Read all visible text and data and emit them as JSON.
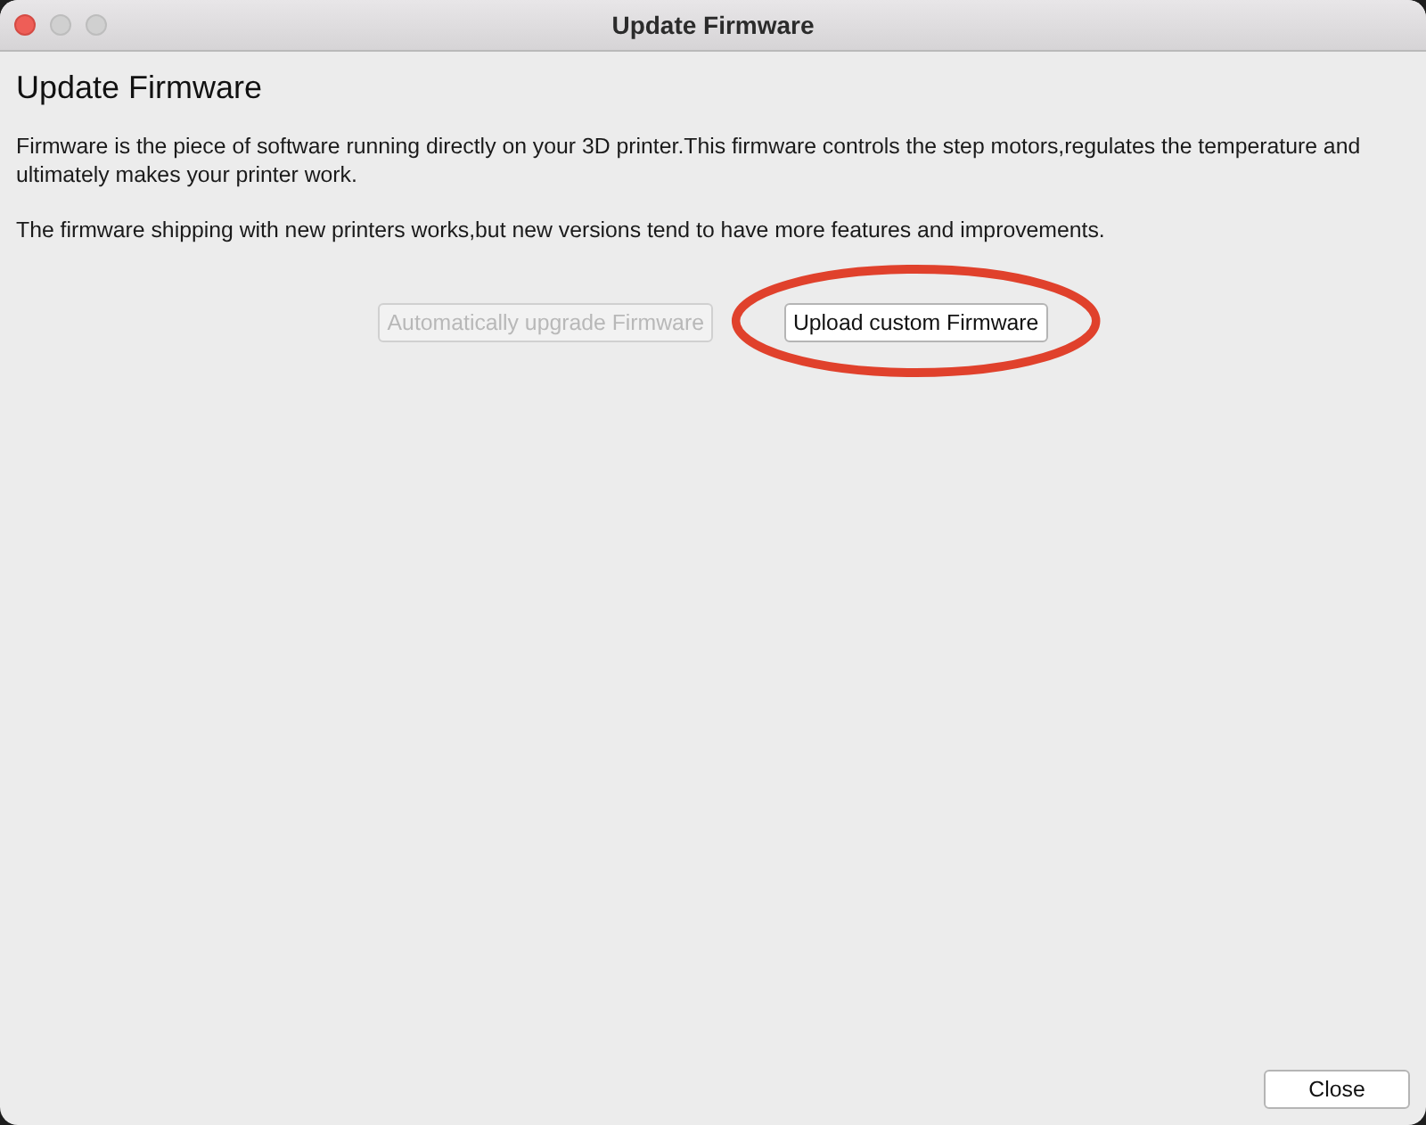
{
  "window": {
    "title": "Update Firmware"
  },
  "heading": "Update Firmware",
  "paragraphs": [
    "Firmware is the piece of software running directly on your 3D printer.This firmware controls the step motors,regulates the temperature and ultimately makes your printer work.",
    "The firmware shipping with new printers works,but new versions tend to have more features and improvements."
  ],
  "buttons": [
    {
      "label": "Automatically upgrade Firmware",
      "disabled": true
    },
    {
      "label": "Upload custom Firmware",
      "disabled": false
    }
  ],
  "annotation": {
    "kind": "ellipse",
    "color": "#e0412c"
  },
  "footer_button": "Close"
}
